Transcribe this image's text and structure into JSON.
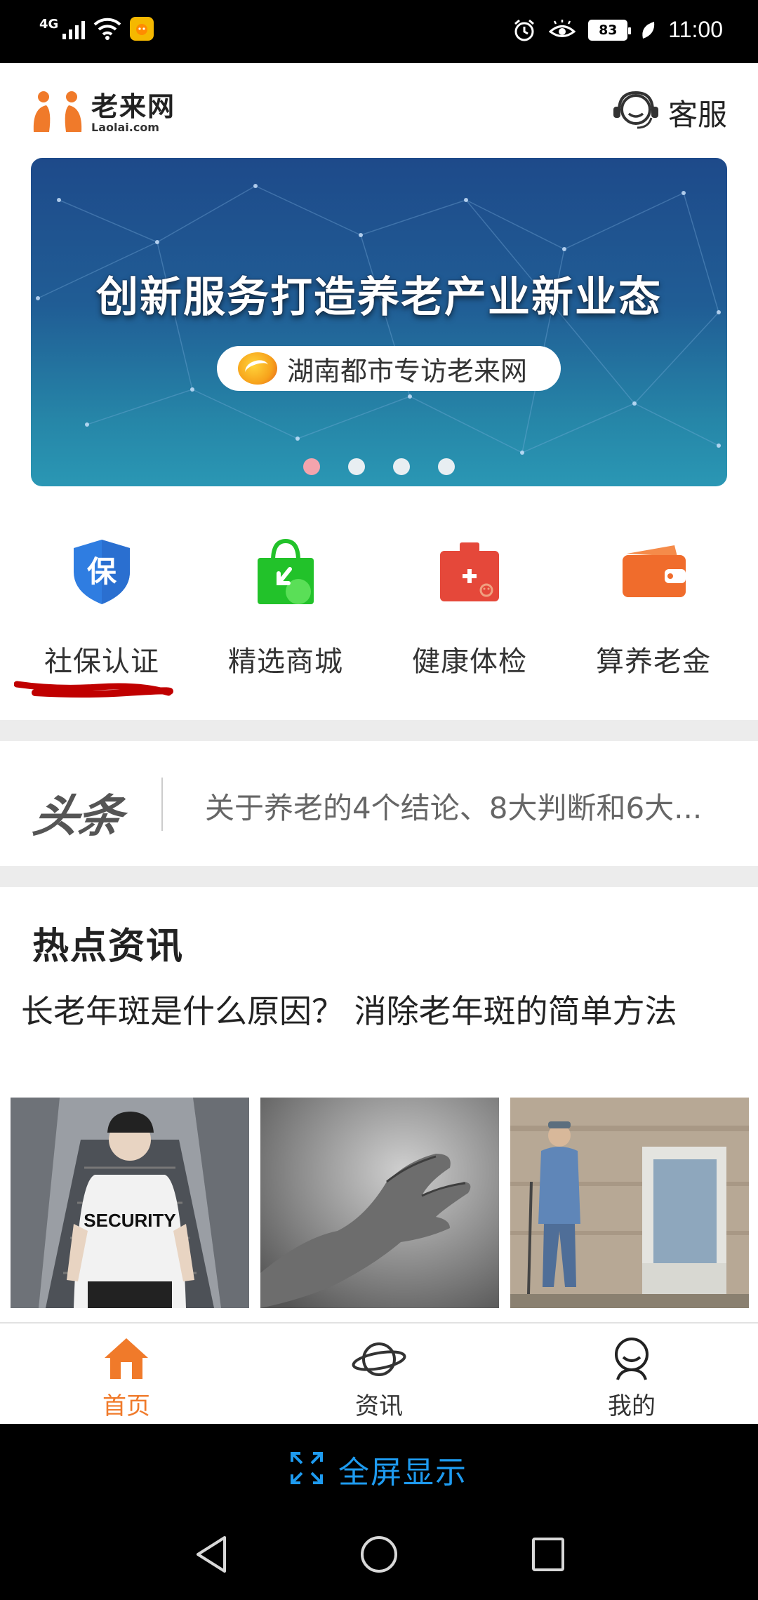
{
  "status_bar": {
    "network": "4G",
    "battery": "83",
    "time": "11:00"
  },
  "header": {
    "logo_cn": "老来网",
    "logo_en": "Laolai.com",
    "service_label": "客服"
  },
  "banner": {
    "title": "创新服务打造养老产业新业态",
    "subtitle": "湖南都市专访老来网",
    "slide_count": 4,
    "active_slide": 1
  },
  "quick_menu": [
    {
      "label": "社保认证",
      "icon": "shield-bao-icon",
      "color": "#2f7de1"
    },
    {
      "label": "精选商城",
      "icon": "shopping-bag-icon",
      "color": "#22c22a"
    },
    {
      "label": "健康体检",
      "icon": "medical-kit-icon",
      "color": "#e5483a"
    },
    {
      "label": "算养老金",
      "icon": "wallet-icon",
      "color": "#f06c2c"
    }
  ],
  "headline": {
    "badge": "头条",
    "text": "关于养老的4个结论、8大判断和6大..."
  },
  "hot_news": {
    "section_title": "热点资讯",
    "article_title": "长老年斑是什么原因？ 消除老年斑的简单方法",
    "thumb_text": "SECURITY"
  },
  "tabbar": {
    "tabs": [
      {
        "label": "首页",
        "icon": "home-icon",
        "active": true
      },
      {
        "label": "资讯",
        "icon": "planet-icon",
        "active": false
      },
      {
        "label": "我的",
        "icon": "user-icon",
        "active": false
      }
    ],
    "active_color": "#f07a2a"
  },
  "fullscreen": {
    "label": "全屏显示",
    "color": "#1e9bf0"
  }
}
